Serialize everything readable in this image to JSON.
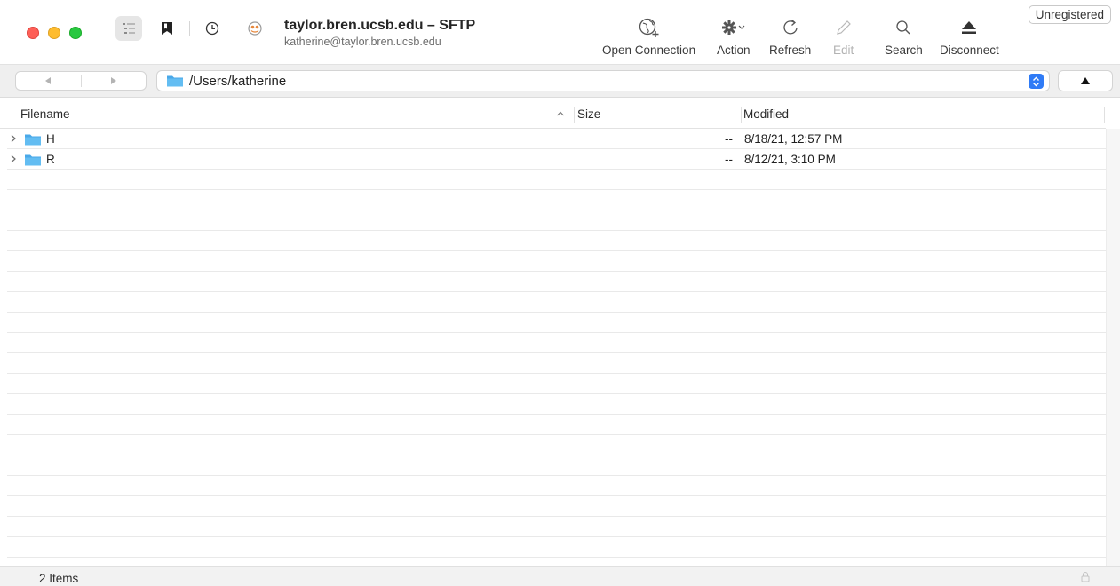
{
  "window": {
    "title": "taylor.bren.ucsb.edu – SFTP",
    "subtitle": "katherine@taylor.bren.ucsb.edu",
    "badge": "Unregistered"
  },
  "toolbar": {
    "items": [
      {
        "label": "Open Connection",
        "icon": "globe-plus-icon"
      },
      {
        "label": "Action",
        "icon": "gear-chevron-icon"
      },
      {
        "label": "Refresh",
        "icon": "refresh-icon"
      },
      {
        "label": "Edit",
        "icon": "pencil-icon",
        "disabled": true
      },
      {
        "label": "Search",
        "icon": "search-icon"
      },
      {
        "label": "Disconnect",
        "icon": "eject-icon"
      }
    ]
  },
  "pathbar": {
    "path": "/Users/katherine"
  },
  "columns": {
    "filename": "Filename",
    "size": "Size",
    "modified": "Modified"
  },
  "files": [
    {
      "name": "H",
      "size": "--",
      "modified": "8/18/21, 12:57 PM"
    },
    {
      "name": "R",
      "size": "--",
      "modified": "8/12/21, 3:10 PM"
    }
  ],
  "status": {
    "count": "2 Items"
  },
  "colors": {
    "accent": "#2f7bf6",
    "folder": "#5cb8ee",
    "close": "#fe5f57",
    "minimize": "#febc2e",
    "maximize": "#28c840"
  }
}
